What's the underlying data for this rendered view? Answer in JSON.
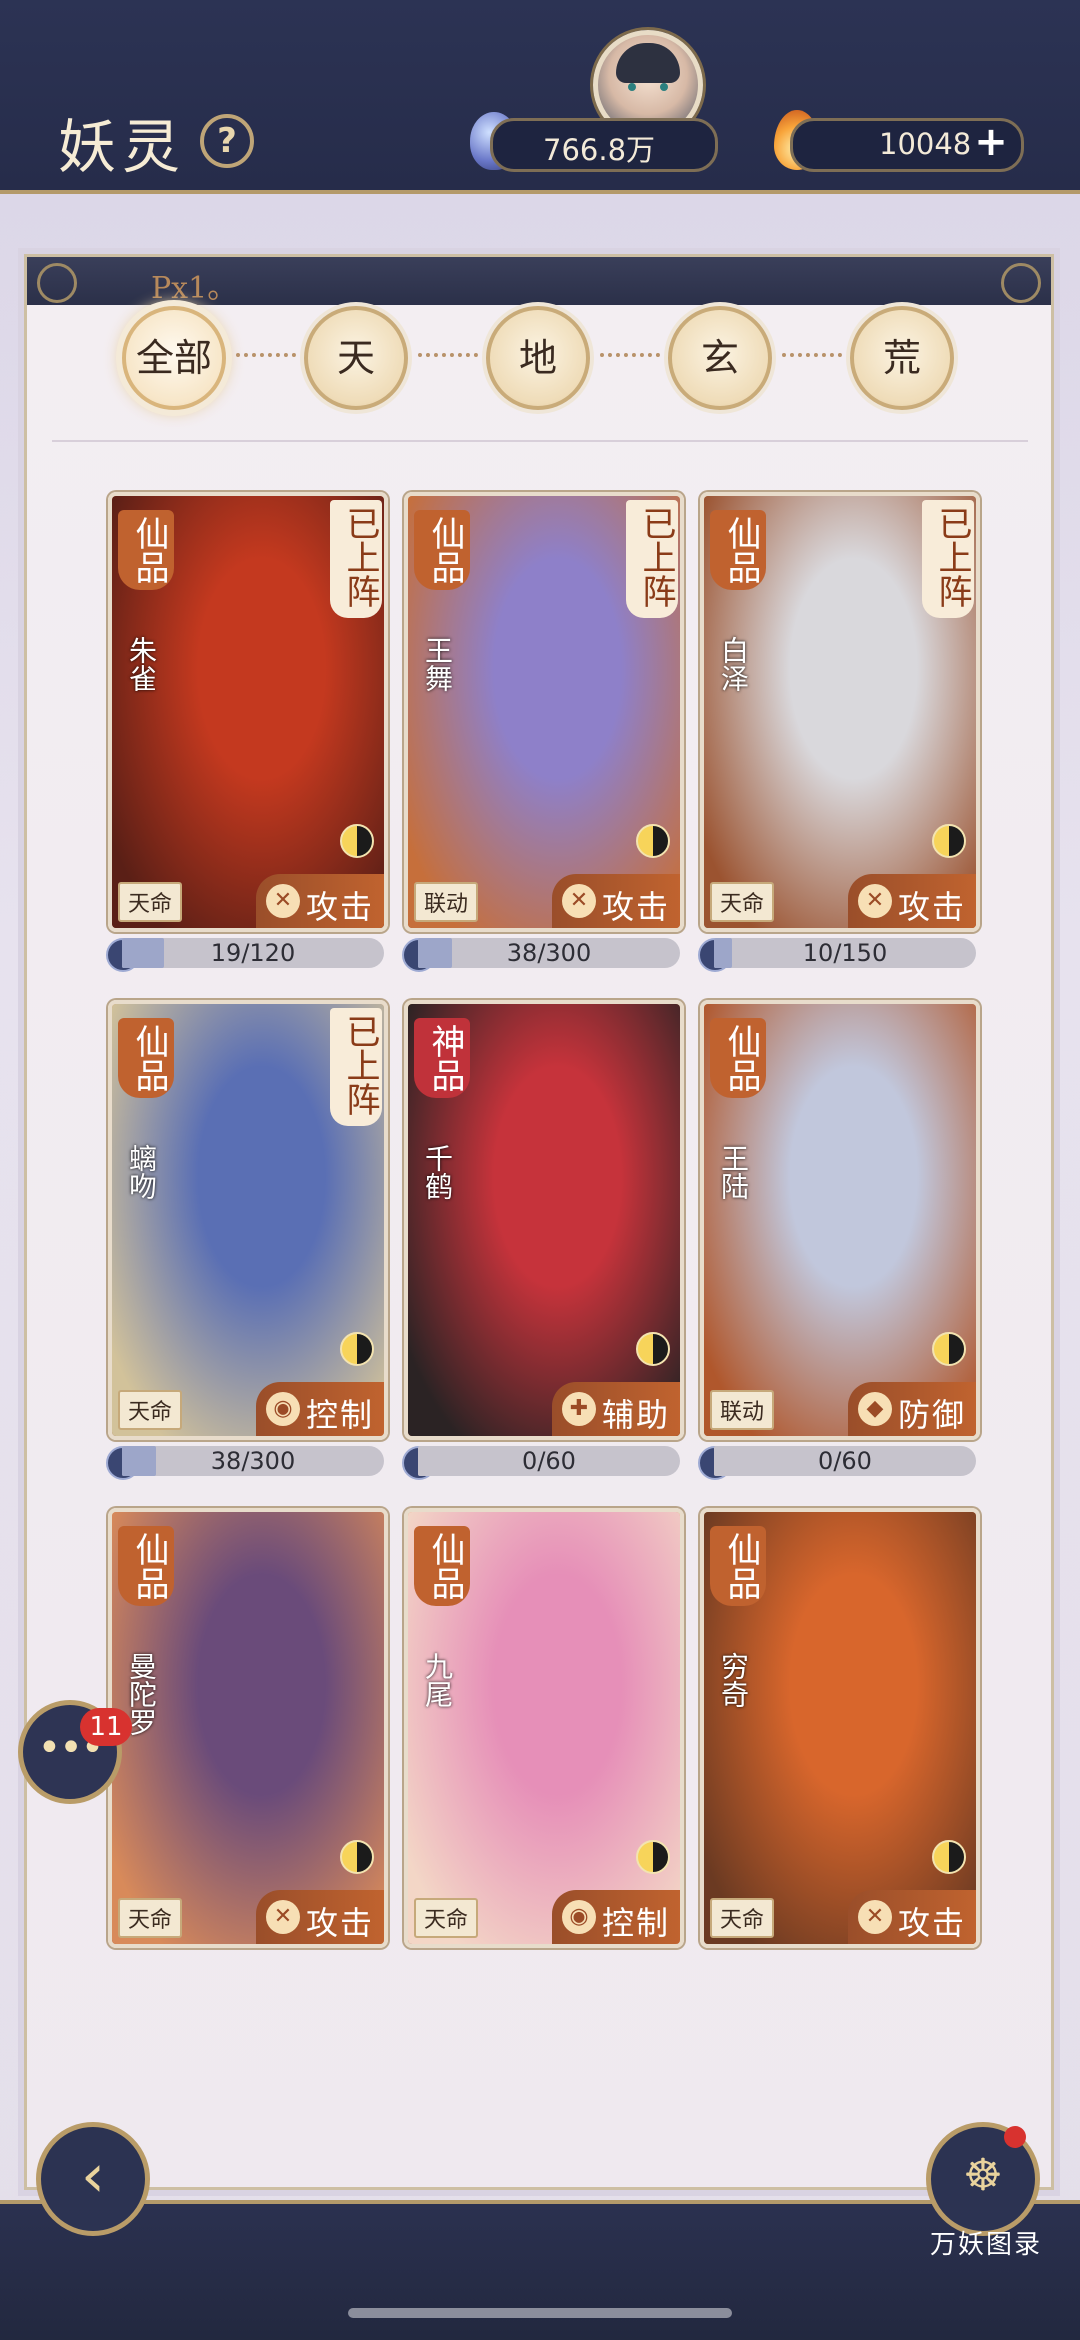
{
  "header": {
    "title": "妖灵",
    "currency_gems": "766.8万",
    "currency_flames": "10048"
  },
  "panel": {
    "header_text": "Px1。"
  },
  "filters": [
    "全部",
    "天",
    "地",
    "玄",
    "荒"
  ],
  "active_filter": "全部",
  "cards": [
    {
      "grade": "仙品",
      "name": "朱雀",
      "deployed": "已上阵",
      "tag": "天命",
      "role": "攻击",
      "progress": "19/120",
      "fill": 0.16,
      "c1": "#c4391f",
      "c2": "#5a1f16"
    },
    {
      "grade": "仙品",
      "name": "王舞",
      "deployed": "已上阵",
      "tag": "联动",
      "role": "攻击",
      "progress": "38/300",
      "fill": 0.13,
      "c1": "#8e80c9",
      "c2": "#c66f3b"
    },
    {
      "grade": "仙品",
      "name": "白泽",
      "deployed": "已上阵",
      "tag": "天命",
      "role": "攻击",
      "progress": "10/150",
      "fill": 0.07,
      "c1": "#d9d8dc",
      "c2": "#9b5330"
    },
    {
      "grade": "仙品",
      "name": "螭吻",
      "deployed": "已上阵",
      "tag": "天命",
      "role": "控制",
      "progress": "38/300",
      "fill": 0.13,
      "c1": "#5a6fb4",
      "c2": "#d2c29a"
    },
    {
      "grade": "神品",
      "name": "千鹤",
      "deployed": "",
      "tag": "",
      "role": "辅助",
      "progress": "0/60",
      "fill": 0.0,
      "c1": "#c6333b",
      "c2": "#2b2324"
    },
    {
      "grade": "仙品",
      "name": "王陆",
      "deployed": "",
      "tag": "联动",
      "role": "防御",
      "progress": "0/60",
      "fill": 0.0,
      "c1": "#c1c7dc",
      "c2": "#b0572c"
    },
    {
      "grade": "仙品",
      "name": "曼陀罗",
      "deployed": "",
      "tag": "天命",
      "role": "攻击",
      "progress": "",
      "fill": 0.0,
      "c1": "#6a4b7a",
      "c2": "#d88a5a"
    },
    {
      "grade": "仙品",
      "name": "九尾",
      "deployed": "",
      "tag": "天命",
      "role": "控制",
      "progress": "",
      "fill": 0.0,
      "c1": "#e68fb8",
      "c2": "#f3d6c6"
    },
    {
      "grade": "仙品",
      "name": "穷奇",
      "deployed": "",
      "tag": "天命",
      "role": "攻击",
      "progress": "",
      "fill": 0.0,
      "c1": "#d8662c",
      "c2": "#6b3a22"
    }
  ],
  "chat_badge": "11",
  "bottom": {
    "book_label": "万妖图录"
  }
}
